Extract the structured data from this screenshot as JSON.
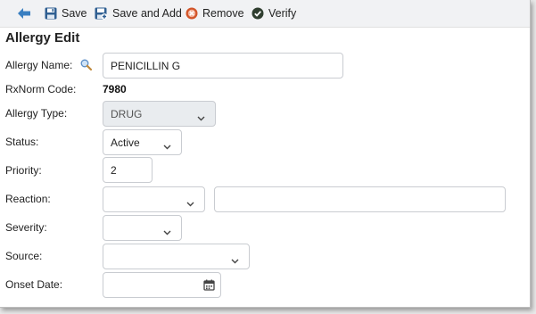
{
  "toolbar": {
    "back_icon": "arrow-left-icon",
    "save_label": "Save",
    "save_and_add_label": "Save and Add",
    "remove_label": "Remove",
    "verify_label": "Verify"
  },
  "form": {
    "title": "Allergy Edit",
    "allergy_name_label": "Allergy Name:",
    "allergy_name_value": "PENICILLIN G",
    "rxnorm_label": "RxNorm Code:",
    "rxnorm_value": "7980",
    "allergy_type_label": "Allergy Type:",
    "allergy_type_value": "DRUG",
    "status_label": "Status:",
    "status_value": "Active",
    "priority_label": "Priority:",
    "priority_value": "2",
    "reaction_label": "Reaction:",
    "reaction_value": "",
    "reaction_detail_value": "",
    "severity_label": "Severity:",
    "severity_value": "",
    "source_label": "Source:",
    "source_value": "",
    "onset_date_label": "Onset Date:",
    "onset_date_value": ""
  },
  "colors": {
    "accent_blue": "#3a7fc1",
    "remove_red": "#d2552a",
    "verify_green": "#2f3e2f",
    "disabled_bg": "#e9ecef"
  }
}
